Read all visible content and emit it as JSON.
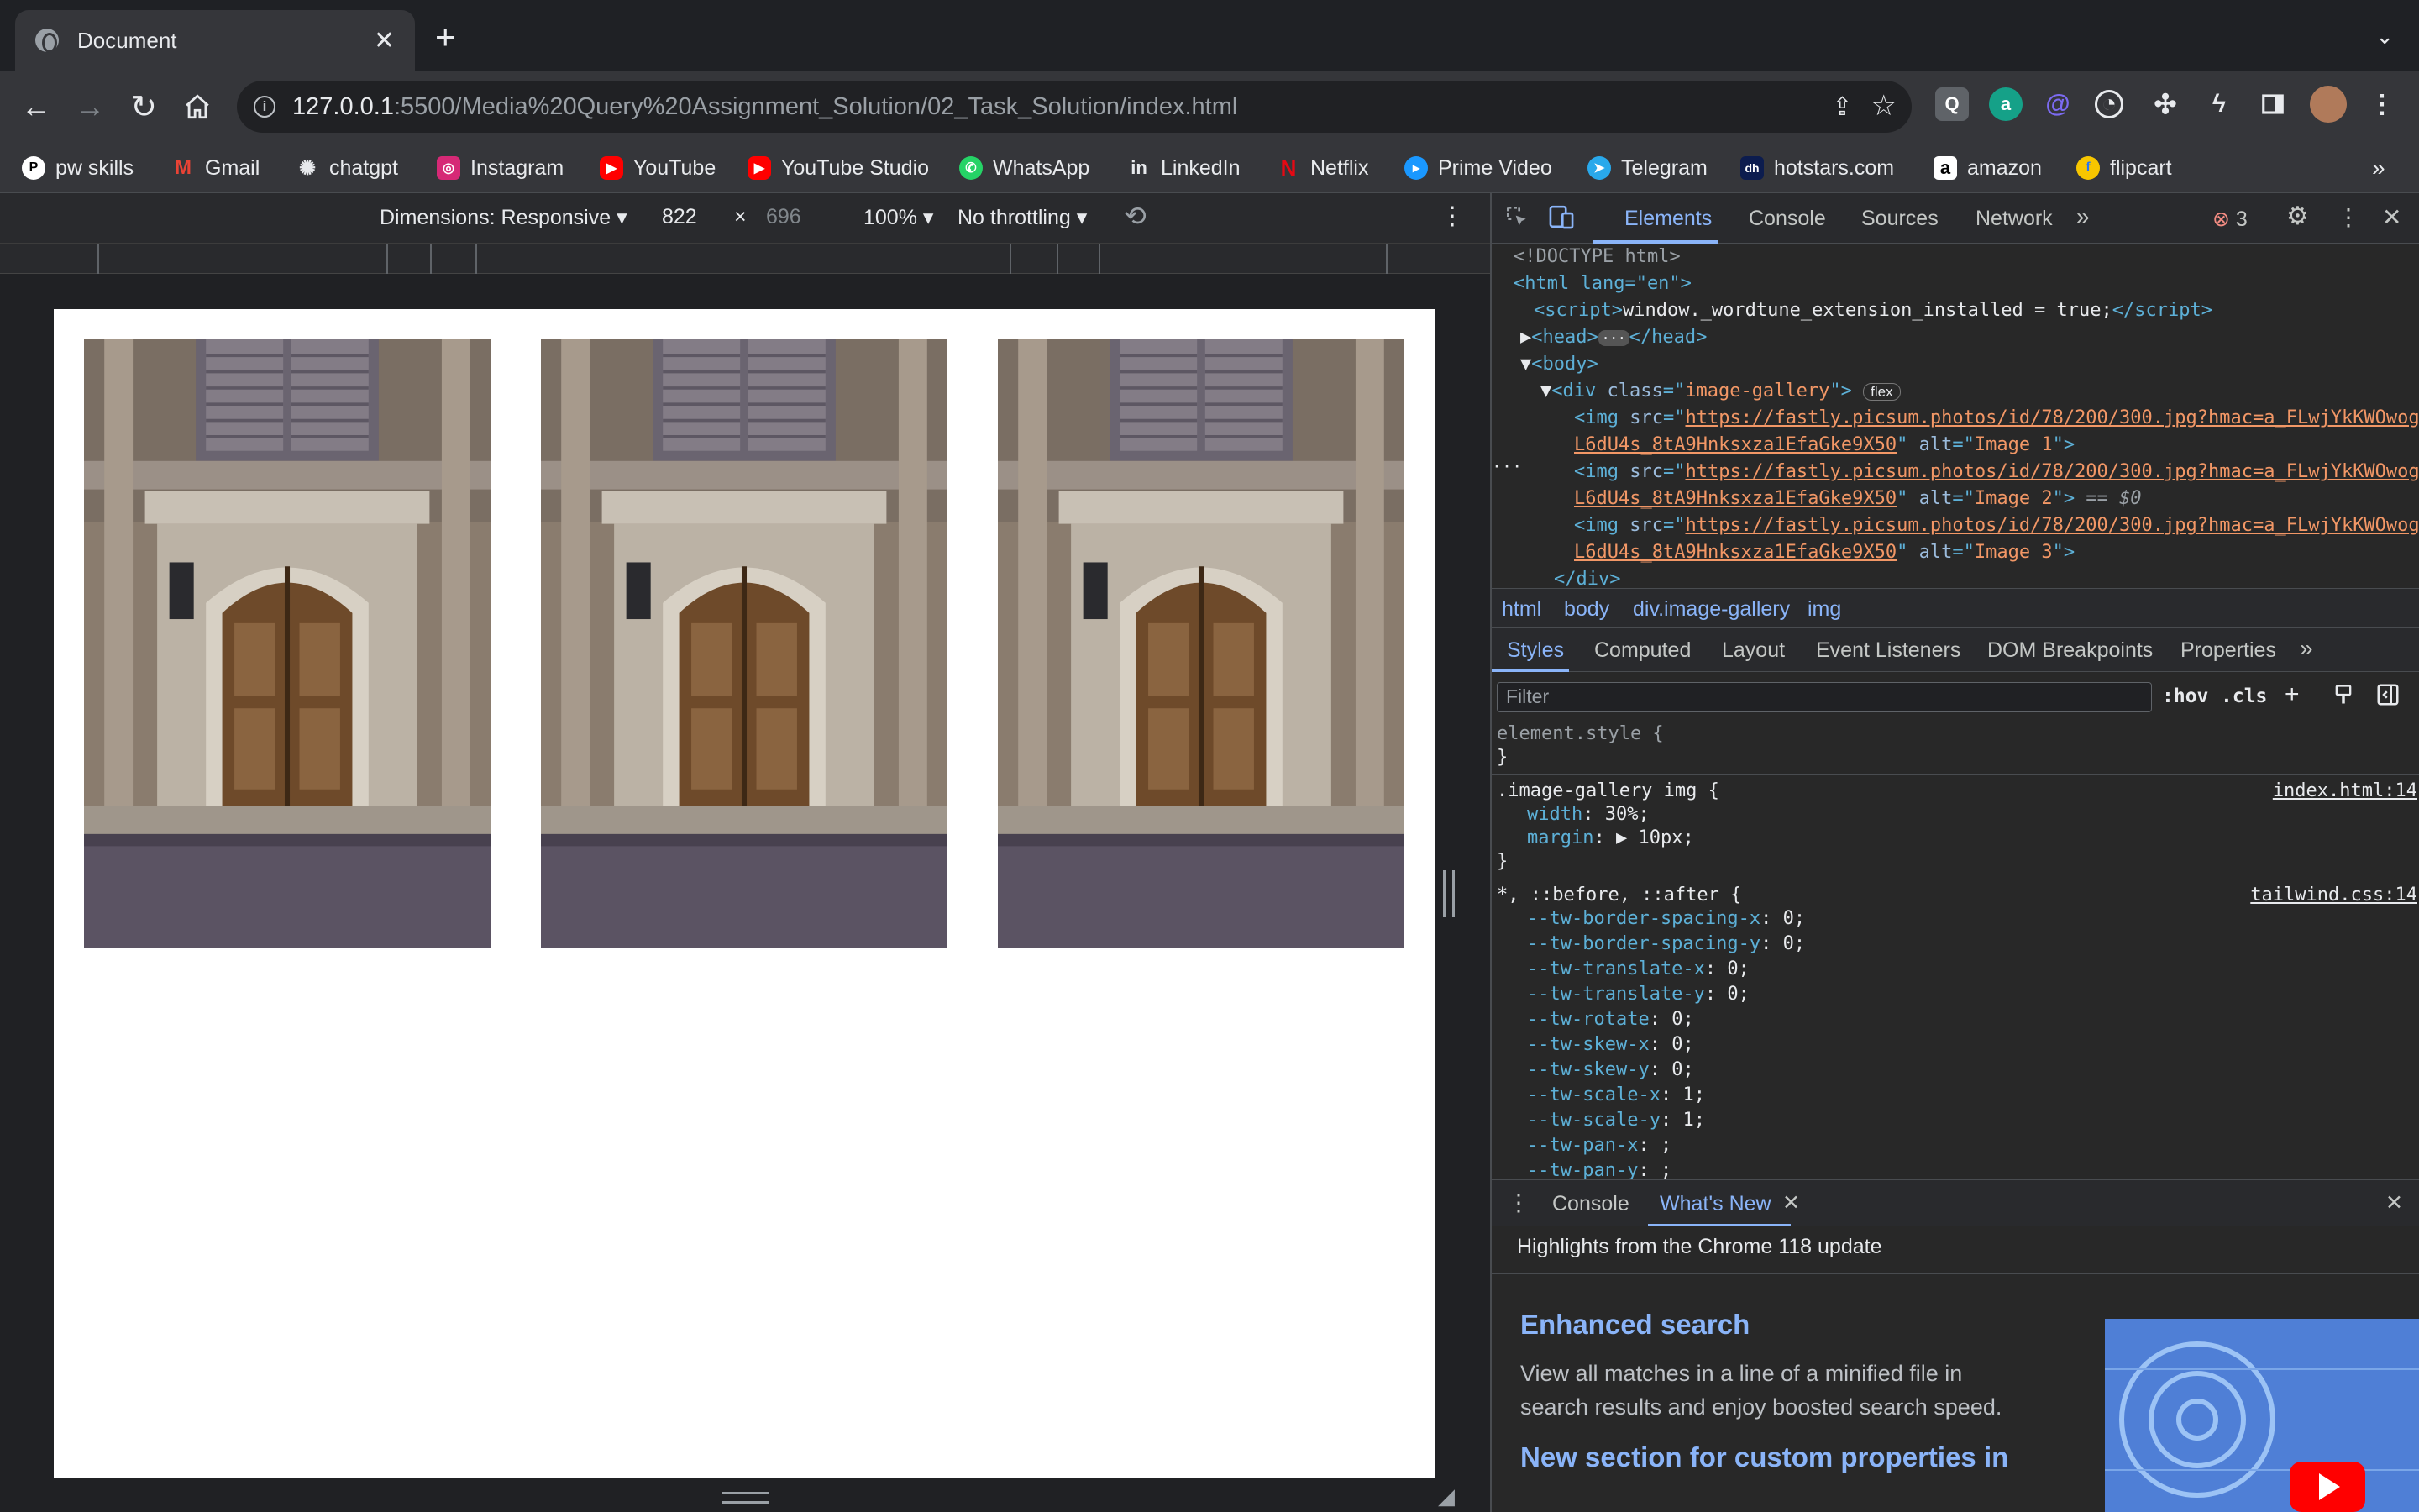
{
  "browser": {
    "tab_title": "Document",
    "url_host": "127.0.0.1",
    "url_path": ":5500/Media%20Query%20Assignment_Solution/02_Task_Solution/index.html",
    "bookmarks": [
      "pw skills",
      "Gmail",
      "chatgpt",
      "Instagram",
      "YouTube",
      "YouTube Studio",
      "WhatsApp",
      "LinkedIn",
      "Netflix",
      "Prime Video",
      "Telegram",
      "hotstars.com",
      "amazon",
      "flipcart"
    ],
    "bookmarks_overflow": "»"
  },
  "device_toolbar": {
    "dimensions_label": "Dimensions: Responsive",
    "width": "822",
    "times": "×",
    "height": "696",
    "zoom": "100%",
    "throttling": "No throttling"
  },
  "page": {
    "images": [
      {
        "alt": "Image 1"
      },
      {
        "alt": "Image 2"
      },
      {
        "alt": "Image 3"
      }
    ]
  },
  "devtools": {
    "tabs": [
      "Elements",
      "Console",
      "Sources",
      "Network"
    ],
    "more_tabs": "»",
    "error_count": "3",
    "dom": {
      "doctype": "<!DOCTYPE html>",
      "html_open": "<html lang=\"en\">",
      "script_text": "window._wordtune_extension_installed = true;",
      "head": "</head>",
      "body": "<body>",
      "div_class": "image-gallery",
      "flex_badge": "flex",
      "img_src_line1": "https://fastly.picsum.photos/id/78/200/300.jpg?hmac=a_FLwjYkKWOwog",
      "img_src_line2": "L6dU4s_8tA9Hnksxza1EfaGke9X50",
      "img_alts": [
        "Image 1",
        "Image 2",
        "Image 3"
      ],
      "selected_marker": "== $0",
      "div_close": "</div>"
    },
    "breadcrumbs": [
      "html",
      "body",
      "div.image-gallery",
      "img"
    ],
    "style_tabs": [
      "Styles",
      "Computed",
      "Layout",
      "Event Listeners",
      "DOM Breakpoints",
      "Properties"
    ],
    "filter_placeholder": "Filter",
    "hov": ":hov",
    "cls": ".cls",
    "styles": {
      "element_style": "element.style {",
      "close": "}",
      "gallery_selector": ".image-gallery img {",
      "gallery_source": "index.html:14",
      "gallery_props": [
        {
          "name": "width",
          "value": "30%;"
        },
        {
          "name": "margin",
          "value": "▶ 10px;"
        }
      ],
      "universal_selector": "*, ::before, ::after {",
      "universal_source": "tailwind.css:14",
      "universal_props": [
        {
          "name": "--tw-border-spacing-x",
          "value": "0;"
        },
        {
          "name": "--tw-border-spacing-y",
          "value": "0;"
        },
        {
          "name": "--tw-translate-x",
          "value": "0;"
        },
        {
          "name": "--tw-translate-y",
          "value": "0;"
        },
        {
          "name": "--tw-rotate",
          "value": "0;"
        },
        {
          "name": "--tw-skew-x",
          "value": "0;"
        },
        {
          "name": "--tw-skew-y",
          "value": "0;"
        },
        {
          "name": "--tw-scale-x",
          "value": "1;"
        },
        {
          "name": "--tw-scale-y",
          "value": "1;"
        },
        {
          "name": "--tw-pan-x",
          "value": ";"
        },
        {
          "name": "--tw-pan-y",
          "value": ";"
        }
      ]
    },
    "drawer": {
      "tabs": [
        "Console",
        "What's New"
      ],
      "highlights": "Highlights from the Chrome 118 update",
      "feature1_title": "Enhanced search",
      "feature1_desc_1": "View all matches in a line of a minified file in",
      "feature1_desc_2": "search results and enjoy boosted search speed.",
      "feature2_title": "New section for custom properties in"
    }
  }
}
